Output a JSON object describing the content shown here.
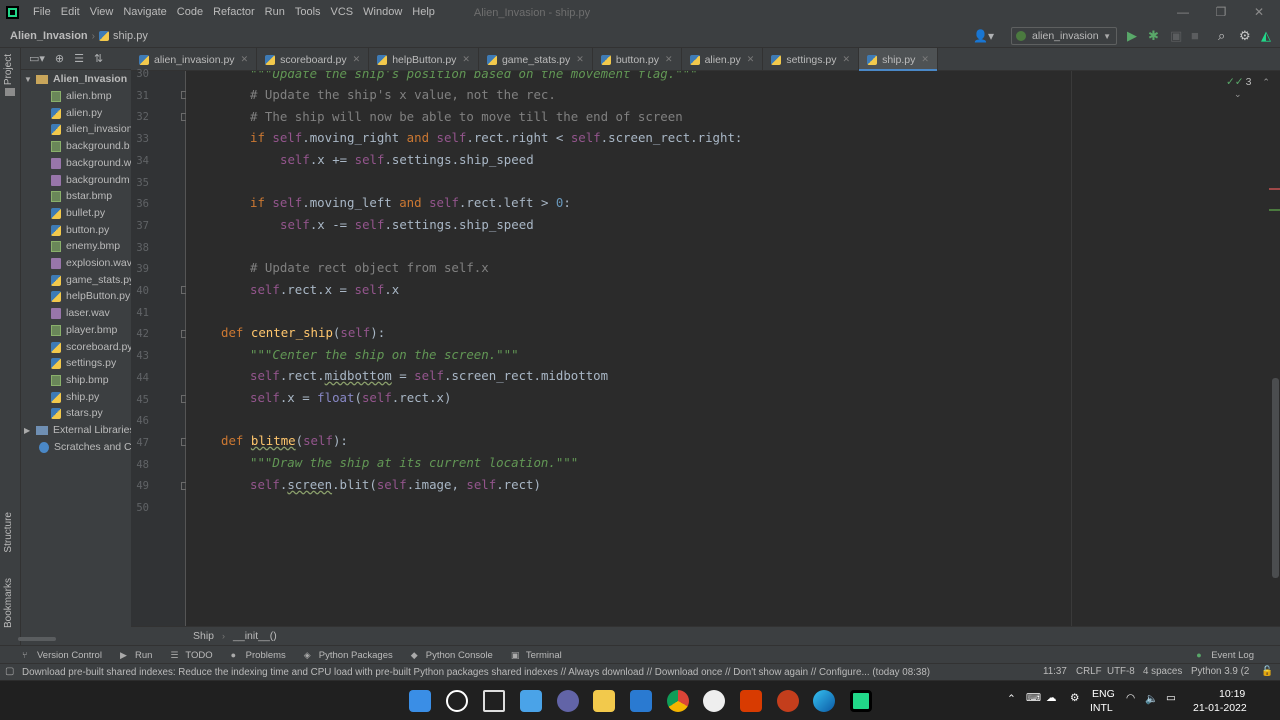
{
  "window": {
    "menus": [
      "File",
      "Edit",
      "View",
      "Navigate",
      "Code",
      "Refactor",
      "Run",
      "Tools",
      "VCS",
      "Window",
      "Help"
    ],
    "title": "Alien_Invasion - ship.py",
    "minimize": "—",
    "restore": "❐",
    "close": "✕"
  },
  "navbar": {
    "project": "Alien_Invasion",
    "file": "ship.py",
    "run_config": "alien_invasion"
  },
  "left_strip": {
    "project_label": "Project",
    "structure_label": "Structure",
    "bookmarks_label": "Bookmarks"
  },
  "project_tree": {
    "root": "Alien_Invasion",
    "root_suffix": "C",
    "files": [
      {
        "name": "alien.bmp",
        "type": "bmp"
      },
      {
        "name": "alien.py",
        "type": "py"
      },
      {
        "name": "alien_invasion",
        "type": "py"
      },
      {
        "name": "background.b",
        "type": "bmp"
      },
      {
        "name": "background.w",
        "type": "wav"
      },
      {
        "name": "backgroundm",
        "type": "wav"
      },
      {
        "name": "bstar.bmp",
        "type": "bmp"
      },
      {
        "name": "bullet.py",
        "type": "py"
      },
      {
        "name": "button.py",
        "type": "py"
      },
      {
        "name": "enemy.bmp",
        "type": "bmp"
      },
      {
        "name": "explosion.wav",
        "type": "wav"
      },
      {
        "name": "game_stats.py",
        "type": "py"
      },
      {
        "name": "helpButton.py",
        "type": "py"
      },
      {
        "name": "laser.wav",
        "type": "wav"
      },
      {
        "name": "player.bmp",
        "type": "bmp"
      },
      {
        "name": "scoreboard.py",
        "type": "py"
      },
      {
        "name": "settings.py",
        "type": "py"
      },
      {
        "name": "ship.bmp",
        "type": "bmp"
      },
      {
        "name": "ship.py",
        "type": "py"
      },
      {
        "name": "stars.py",
        "type": "py"
      }
    ],
    "external_libraries": "External Libraries",
    "scratches": "Scratches and Co"
  },
  "tabs": [
    {
      "label": "alien_invasion.py",
      "active": false
    },
    {
      "label": "scoreboard.py",
      "active": false
    },
    {
      "label": "helpButton.py",
      "active": false
    },
    {
      "label": "game_stats.py",
      "active": false
    },
    {
      "label": "button.py",
      "active": false
    },
    {
      "label": "alien.py",
      "active": false
    },
    {
      "label": "settings.py",
      "active": false
    },
    {
      "label": "ship.py",
      "active": true
    }
  ],
  "editor": {
    "inspection_count": "3",
    "line_numbers": [
      "30",
      "31",
      "32",
      "33",
      "34",
      "35",
      "36",
      "37",
      "38",
      "39",
      "40",
      "41",
      "42",
      "43",
      "44",
      "45",
      "46",
      "47",
      "48",
      "49",
      "50"
    ],
    "code": {
      "l30": "\"\"\"Update the ship's position based on the movement flag.\"\"\"",
      "l31": "# Update the ship's x value, not the rec.",
      "l32": "# The ship will now be able to move till the end of screen",
      "l33_kw": "if",
      "l33_a": ".moving_right ",
      "l33_and": "and",
      "l33_b": ".rect.right < ",
      "l33_c": ".screen_rect.right:",
      "l34_a": ".x += ",
      "l34_b": ".settings.ship_speed",
      "l36_kw": "if",
      "l36_a": ".moving_left ",
      "l36_and": "and",
      "l36_b": ".rect.left > ",
      "l36_num": "0",
      "l36_c": ":",
      "l37_a": ".x -= ",
      "l37_b": ".settings.ship_speed",
      "l39": "# Update rect object from self.x",
      "l40_a": ".rect.x = ",
      "l40_b": ".x",
      "l42_def": "def",
      "l42_fn": "center_ship",
      "l42_a": "(",
      "l42_b": "):",
      "l43": "\"\"\"Center the ship on the screen.\"\"\"",
      "l44_a": ".rect.",
      "l44_attr": "midbottom",
      "l44_b": " = ",
      "l44_c": ".screen_rect.midbottom",
      "l45_a": ".x = ",
      "l45_float": "float",
      "l45_b": "(",
      "l45_c": ".rect.x)",
      "l47_def": "def",
      "l47_fn": "blitme",
      "l47_a": "(",
      "l47_b": "):",
      "l48": "\"\"\"Draw the ship at its current location.\"\"\"",
      "l49_a": ".",
      "l49_attr": "screen",
      "l49_b": ".blit(",
      "l49_c": ".image, ",
      "l49_d": ".rect)",
      "self": "self"
    },
    "crumbs": [
      "Ship",
      "__init__()"
    ]
  },
  "tool_windows": [
    "Version Control",
    "Run",
    "TODO",
    "Problems",
    "Python Packages",
    "Python Console",
    "Terminal",
    "Event Log"
  ],
  "status": {
    "message": "Download pre-built shared indexes: Reduce the indexing time and CPU load with pre-built Python packages shared indexes // Always download // Download once // Don't show again // Configure... (today 08:38)",
    "position": "11:37",
    "line_sep": "CRLF",
    "encoding": "UTF-8",
    "indent": "4 spaces",
    "interpreter": "Python 3.9 (2"
  },
  "taskbar": {
    "lang_top": "ENG",
    "lang_bottom": "INTL",
    "time": "10:19",
    "date": "21-01-2022"
  },
  "colors": {
    "accent": "#4a88c7",
    "keyword": "#cc7832",
    "self": "#94558d",
    "docstring": "#629755",
    "function": "#ffc66d"
  }
}
